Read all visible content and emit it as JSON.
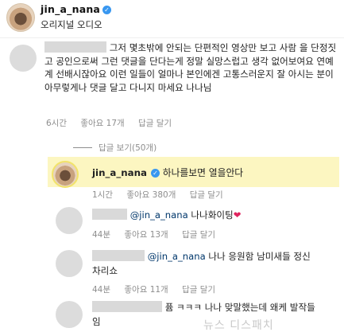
{
  "header": {
    "username": "jin_a_nana",
    "subtitle": "오리지널 오디오"
  },
  "main_comment": {
    "text_line1": "그저 몇초밖에 안되는 단편적인 영상만 보고 사람",
    "text_rest": "을 단정짓고 공인으로써 그런 댓글을 단다는게 정말 실망스럽고 생각 없어보여요 연예계 선배시잖아요 이런 일들이 얼마나 본인에겐 고통스러운지 잘 아시는 분이 아무렇게나 댓글 달고 다니지 마세요 나나님",
    "time": "6시간",
    "likes": "좋아요 17개",
    "reply": "답글 달기"
  },
  "replies_toggle": "답글 보기(50개)",
  "highlighted_reply": {
    "username": "jin_a_nana",
    "text": "하나를보면 열을안다",
    "time": "1시간",
    "likes": "좋아요 380개",
    "reply": "답글 달기"
  },
  "reply2": {
    "mention": "@jin_a_nana",
    "text": "나나화이팅",
    "time": "44분",
    "likes": "좋아요 13개",
    "reply": "답글 달기"
  },
  "reply3": {
    "mention": "@jin_a_nana",
    "text_line1": "나나 응원함 남미새들 정신",
    "text_line2": "차리쇼",
    "time": "44분",
    "likes": "좋아요 11개",
    "reply": "답글 달기"
  },
  "reply4": {
    "text_line1": "퓸 ㅋㅋㅋ 나나 맞말했는데 왜케 발작들",
    "text_line2": "임"
  },
  "watermark": "뉴스 디스패치"
}
